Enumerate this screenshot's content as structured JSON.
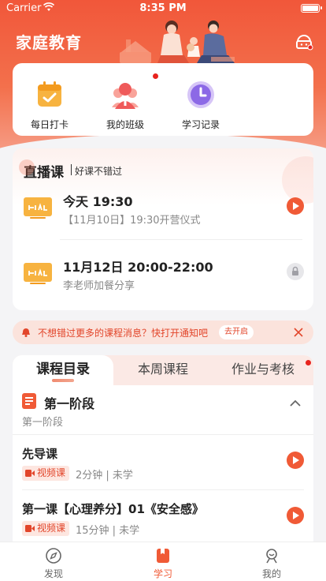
{
  "status_bar": {
    "carrier": "Carrier",
    "time": "8:35 PM"
  },
  "header": {
    "title": "家庭教育"
  },
  "quick_actions": [
    {
      "label": "每日打卡",
      "icon": "calendar-check-icon"
    },
    {
      "label": "我的班级",
      "icon": "class-group-icon",
      "has_red_dot": true
    },
    {
      "label": "学习记录",
      "icon": "clock-icon"
    }
  ],
  "live": {
    "title": "直播课",
    "subtitle": "好课不错过",
    "items": [
      {
        "title": "今天 19:30",
        "desc": "【11月10日】19:30开营仪式",
        "action": "play"
      },
      {
        "title": "11月12日 20:00-22:00",
        "desc": "李老师加餐分享",
        "action": "locked"
      }
    ]
  },
  "notification": {
    "text": "不想错过更多的课程消息？快打开通知吧",
    "button": "去开启"
  },
  "course": {
    "tabs": [
      "课程目录",
      "本周课程",
      "作业与考核"
    ],
    "active_tab": 0,
    "stage": {
      "title": "第一阶段",
      "subtitle": "第一阶段"
    },
    "lessons": [
      {
        "title": "先导课",
        "badge": "视频课",
        "meta": "2分钟 | 未学"
      },
      {
        "title": "第一课【心理养分】01《安全感》",
        "badge": "视频课",
        "meta": "15分钟 | 未学"
      }
    ]
  },
  "tabbar": [
    {
      "label": "发现",
      "icon": "compass-icon"
    },
    {
      "label": "学习",
      "icon": "book-icon",
      "active": true
    },
    {
      "label": "我的",
      "icon": "profile-icon"
    }
  ],
  "colors": {
    "accent": "#f05a36",
    "header_top": "#f1573a",
    "notify_bg": "#fbe3dc"
  }
}
